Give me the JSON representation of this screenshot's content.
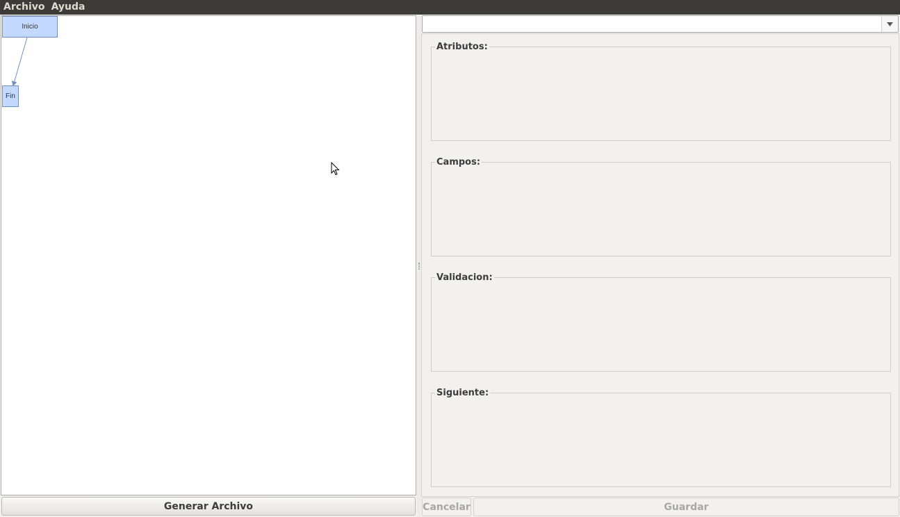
{
  "menu": {
    "items": [
      {
        "label": "Archivo"
      },
      {
        "label": "Ayuda"
      }
    ]
  },
  "diagram": {
    "nodes": [
      {
        "label": "Inicio"
      },
      {
        "label": "Fin"
      }
    ]
  },
  "combo": {
    "value": ""
  },
  "groups": [
    {
      "title": "Atributos:"
    },
    {
      "title": "Campos:"
    },
    {
      "title": "Validacion:"
    },
    {
      "title": "Siguiente:"
    }
  ],
  "buttons": {
    "generar_label": "Generar Archivo",
    "cancelar_label": "Cancelar",
    "guardar_label": "Guardar"
  },
  "colors": {
    "menubar": "#3c3b37",
    "node_fill": "#c3d9ff",
    "node_border": "#6f8fc2"
  }
}
